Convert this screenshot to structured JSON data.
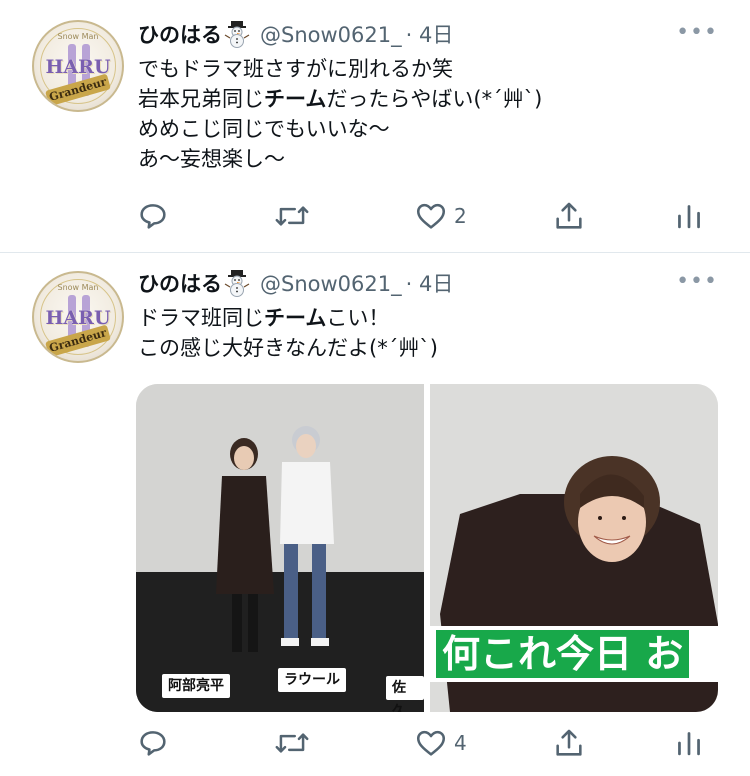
{
  "tweets": [
    {
      "name": "ひのはる",
      "handle": "@Snow0621_",
      "time": "· 4日",
      "lines": [
        {
          "pre": "でもドラマ班さすがに別れるか笑",
          "bold": "",
          "post": ""
        },
        {
          "pre": "岩本兄弟同じ",
          "bold": "チーム",
          "post": "だったらやばい(*´艸`)"
        },
        {
          "pre": "めめこじ同じでもいいな〜",
          "bold": "",
          "post": ""
        },
        {
          "pre": "あ〜妄想楽し〜",
          "bold": "",
          "post": ""
        }
      ],
      "likes": "2"
    },
    {
      "name": "ひのはる",
      "handle": "@Snow0621_",
      "time": "· 4日",
      "lines": [
        {
          "pre": "ドラマ班同じ",
          "bold": "チーム",
          "post": "こい！"
        },
        {
          "pre": "この感じ大好きなんだよ(*´艸`)",
          "bold": "",
          "post": ""
        }
      ],
      "likes": "4",
      "media": {
        "left_captions": [
          "阿部亮平",
          "ラウール",
          "佐久"
        ],
        "right_caption": "何これ今日 お"
      }
    }
  ],
  "avatar": {
    "top_text": "Snow Man",
    "main_text": "HARU",
    "banner_text": "Grandeur"
  },
  "icons": {
    "reply": "reply-icon",
    "retweet": "retweet-icon",
    "like": "heart-icon",
    "share": "share-icon",
    "stats": "analytics-icon",
    "more": "more-icon"
  },
  "more_glyph": "•••",
  "colors": {
    "text": "#0f1419",
    "secondary": "#536471",
    "divider": "#e1e8ed"
  }
}
